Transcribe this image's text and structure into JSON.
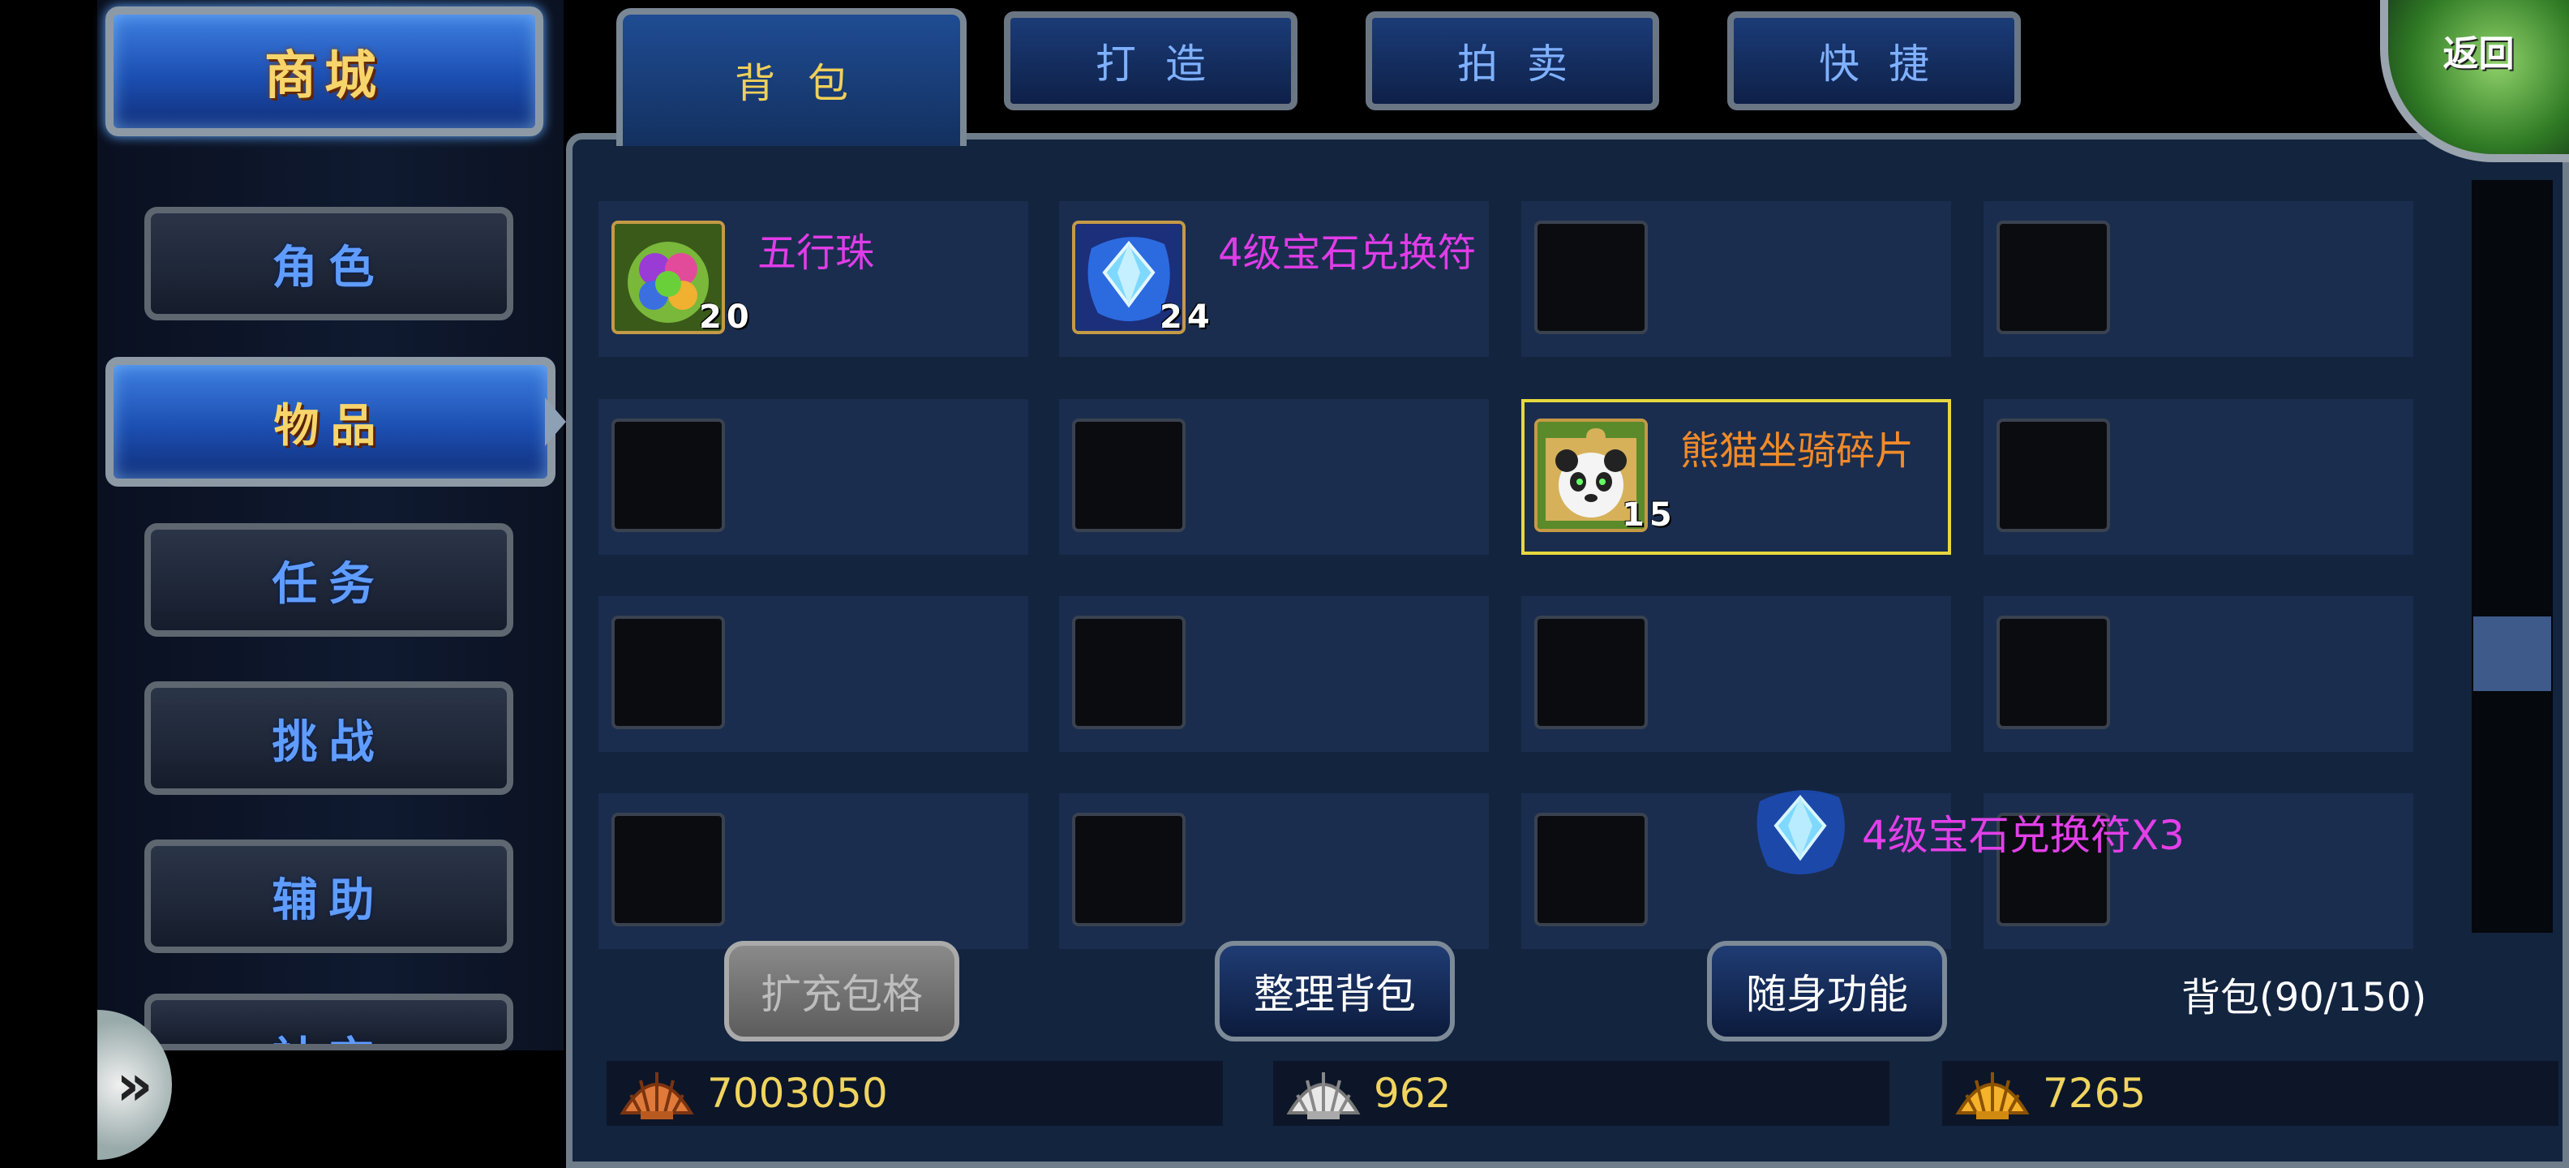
{
  "sidebar": {
    "shop_label": "商城",
    "categories": [
      {
        "label": "角色",
        "active": false
      },
      {
        "label": "物品",
        "active": true
      },
      {
        "label": "任务",
        "active": false
      },
      {
        "label": "挑战",
        "active": false
      },
      {
        "label": "辅助",
        "active": false
      },
      {
        "label": "社交",
        "active": false
      }
    ],
    "expand_glyph": "»"
  },
  "tabs": {
    "active": "背包",
    "others": [
      "打造",
      "拍卖",
      "快捷"
    ]
  },
  "return_label": "返回",
  "inventory": {
    "slots": [
      {
        "name": "五行珠",
        "qty": "20",
        "color": "#e03ce8"
      },
      {
        "name": "4级宝石兑换符",
        "qty": "24",
        "color": "#e03ce8"
      },
      {},
      {},
      {},
      {},
      {
        "name": "熊猫坐骑碎片",
        "qty": "15",
        "color": "#f08a2a",
        "selected": true
      },
      {},
      {},
      {},
      {},
      {},
      {},
      {},
      {},
      {}
    ]
  },
  "tooltip": {
    "text": "4级宝石兑换符X3",
    "color": "#e23fe8"
  },
  "actions": {
    "expand": "扩充包格",
    "sort": "整理背包",
    "portable": "随身功能",
    "bag_count": "背包(90/150)"
  },
  "currency": [
    {
      "icon": "bronze-shell-icon",
      "value": "7003050"
    },
    {
      "icon": "silver-shell-icon",
      "value": "962"
    },
    {
      "icon": "gold-shell-icon",
      "value": "7265"
    }
  ]
}
